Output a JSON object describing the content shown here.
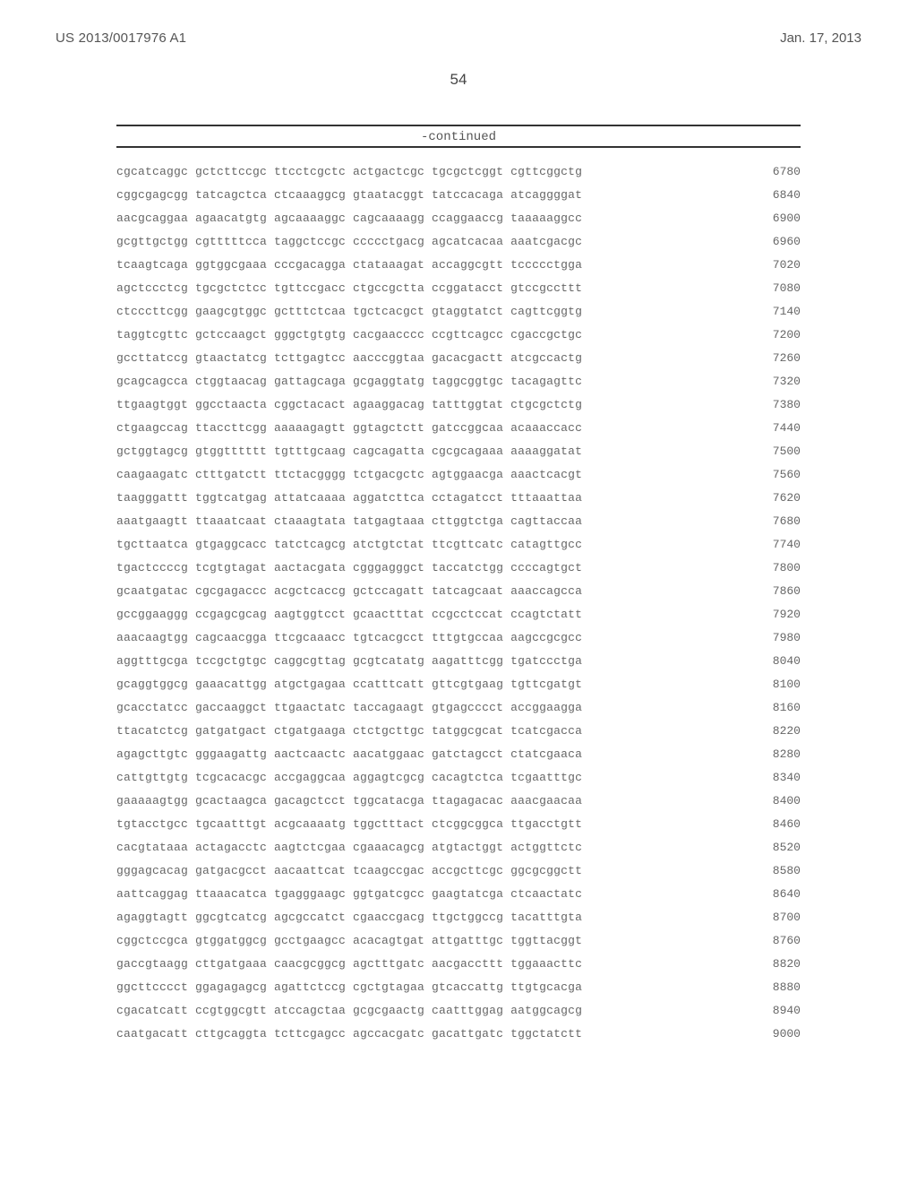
{
  "header": {
    "publication_number": "US 2013/0017976 A1",
    "publication_date": "Jan. 17, 2013"
  },
  "page_number": "54",
  "continued_label": "-continued",
  "sequence": [
    {
      "seq": "cgcatcaggc gctcttccgc ttcctcgctc actgactcgc tgcgctcggt cgttcggctg",
      "pos": "6780"
    },
    {
      "seq": "cggcgagcgg tatcagctca ctcaaaggcg gtaatacggt tatccacaga atcaggggat",
      "pos": "6840"
    },
    {
      "seq": "aacgcaggaa agaacatgtg agcaaaaggc cagcaaaagg ccaggaaccg taaaaaggcc",
      "pos": "6900"
    },
    {
      "seq": "gcgttgctgg cgtttttcca taggctccgc ccccctgacg agcatcacaa aaatcgacgc",
      "pos": "6960"
    },
    {
      "seq": "tcaagtcaga ggtggcgaaa cccgacagga ctataaagat accaggcgtt tccccctgga",
      "pos": "7020"
    },
    {
      "seq": "agctccctcg tgcgctctcc tgttccgacc ctgccgctta ccggatacct gtccgccttt",
      "pos": "7080"
    },
    {
      "seq": "ctcccttcgg gaagcgtggc gctttctcaa tgctcacgct gtaggtatct cagttcggtg",
      "pos": "7140"
    },
    {
      "seq": "taggtcgttc gctccaagct gggctgtgtg cacgaacccc ccgttcagcc cgaccgctgc",
      "pos": "7200"
    },
    {
      "seq": "gccttatccg gtaactatcg tcttgagtcc aacccggtaa gacacgactt atcgccactg",
      "pos": "7260"
    },
    {
      "seq": "gcagcagcca ctggtaacag gattagcaga gcgaggtatg taggcggtgc tacagagttc",
      "pos": "7320"
    },
    {
      "seq": "ttgaagtggt ggcctaacta cggctacact agaaggacag tatttggtat ctgcgctctg",
      "pos": "7380"
    },
    {
      "seq": "ctgaagccag ttaccttcgg aaaaagagtt ggtagctctt gatccggcaa acaaaccacc",
      "pos": "7440"
    },
    {
      "seq": "gctggtagcg gtggtttttt tgtttgcaag cagcagatta cgcgcagaaa aaaaggatat",
      "pos": "7500"
    },
    {
      "seq": "caagaagatc ctttgatctt ttctacgggg tctgacgctc agtggaacga aaactcacgt",
      "pos": "7560"
    },
    {
      "seq": "taagggattt tggtcatgag attatcaaaa aggatcttca cctagatcct tttaaattaa",
      "pos": "7620"
    },
    {
      "seq": "aaatgaagtt ttaaatcaat ctaaagtata tatgagtaaa cttggtctga cagttaccaa",
      "pos": "7680"
    },
    {
      "seq": "tgcttaatca gtgaggcacc tatctcagcg atctgtctat ttcgttcatc catagttgcc",
      "pos": "7740"
    },
    {
      "seq": "tgactccccg tcgtgtagat aactacgata cgggagggct taccatctgg ccccagtgct",
      "pos": "7800"
    },
    {
      "seq": "gcaatgatac cgcgagaccc acgctcaccg gctccagatt tatcagcaat aaaccagcca",
      "pos": "7860"
    },
    {
      "seq": "gccggaaggg ccgagcgcag aagtggtcct gcaactttat ccgcctccat ccagtctatt",
      "pos": "7920"
    },
    {
      "seq": "aaacaagtgg cagcaacgga ttcgcaaacc tgtcacgcct tttgtgccaa aagccgcgcc",
      "pos": "7980"
    },
    {
      "seq": "aggtttgcga tccgctgtgc caggcgttag gcgtcatatg aagatttcgg tgatccctga",
      "pos": "8040"
    },
    {
      "seq": "gcaggtggcg gaaacattgg atgctgagaa ccatttcatt gttcgtgaag tgttcgatgt",
      "pos": "8100"
    },
    {
      "seq": "gcacctatcc gaccaaggct ttgaactatc taccagaagt gtgagcccct accggaagga",
      "pos": "8160"
    },
    {
      "seq": "ttacatctcg gatgatgact ctgatgaaga ctctgcttgc tatggcgcat tcatcgacca",
      "pos": "8220"
    },
    {
      "seq": "agagcttgtc gggaagattg aactcaactc aacatggaac gatctagcct ctatcgaaca",
      "pos": "8280"
    },
    {
      "seq": "cattgttgtg tcgcacacgc accgaggcaa aggagtcgcg cacagtctca tcgaatttgc",
      "pos": "8340"
    },
    {
      "seq": "gaaaaagtgg gcactaagca gacagctcct tggcatacga ttagagacac aaacgaacaa",
      "pos": "8400"
    },
    {
      "seq": "tgtacctgcc tgcaatttgt acgcaaaatg tggctttact ctcggcggca ttgacctgtt",
      "pos": "8460"
    },
    {
      "seq": "cacgtataaa actagacctc aagtctcgaa cgaaacagcg atgtactggt actggttctc",
      "pos": "8520"
    },
    {
      "seq": "gggagcacag gatgacgcct aacaattcat tcaagccgac accgcttcgc ggcgcggctt",
      "pos": "8580"
    },
    {
      "seq": "aattcaggag ttaaacatca tgagggaagc ggtgatcgcc gaagtatcga ctcaactatc",
      "pos": "8640"
    },
    {
      "seq": "agaggtagtt ggcgtcatcg agcgccatct cgaaccgacg ttgctggccg tacatttgta",
      "pos": "8700"
    },
    {
      "seq": "cggctccgca gtggatggcg gcctgaagcc acacagtgat attgatttgc tggttacggt",
      "pos": "8760"
    },
    {
      "seq": "gaccgtaagg cttgatgaaa caacgcggcg agctttgatc aacgaccttt tggaaacttc",
      "pos": "8820"
    },
    {
      "seq": "ggcttcccct ggagagagcg agattctccg cgctgtagaa gtcaccattg ttgtgcacga",
      "pos": "8880"
    },
    {
      "seq": "cgacatcatt ccgtggcgtt atccagctaa gcgcgaactg caatttggag aatggcagcg",
      "pos": "8940"
    },
    {
      "seq": "caatgacatt cttgcaggta tcttcgagcc agccacgatc gacattgatc tggctatctt",
      "pos": "9000"
    }
  ]
}
